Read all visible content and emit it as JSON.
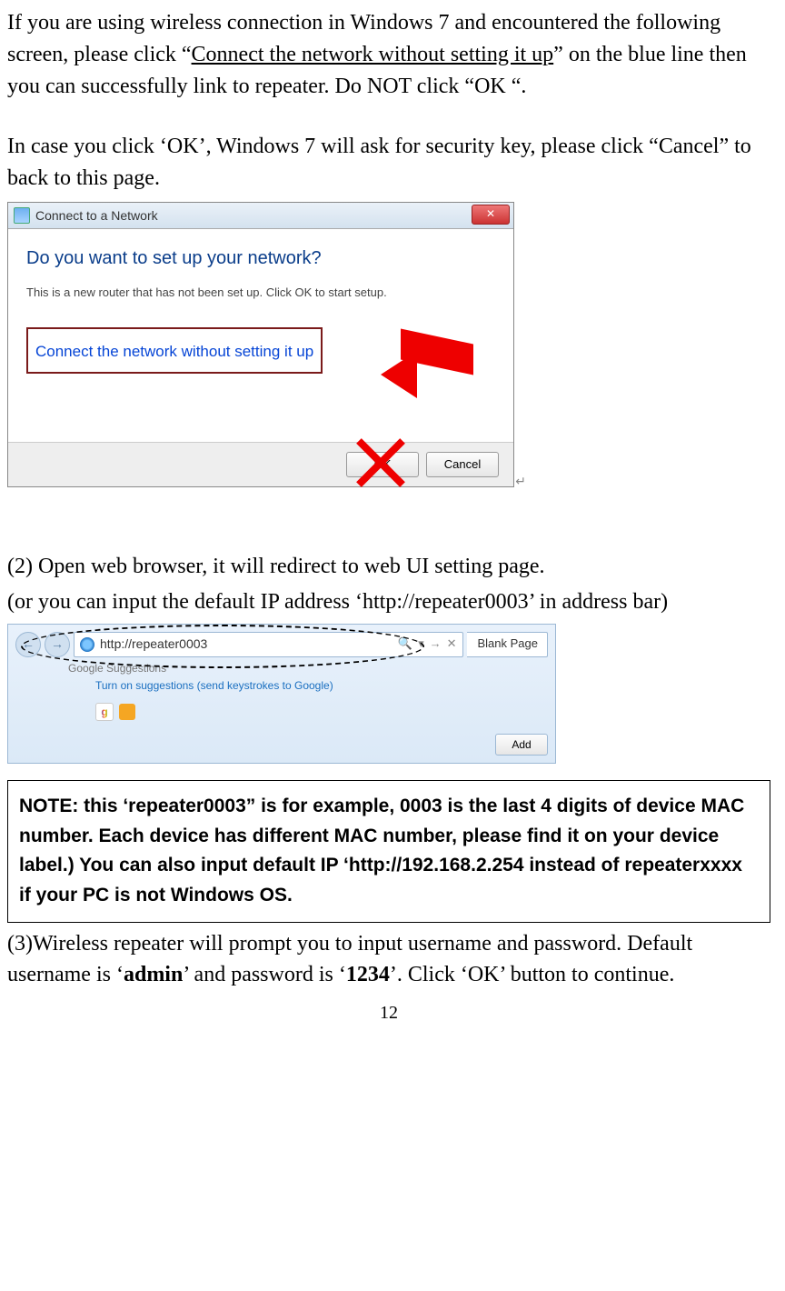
{
  "para1_a": "If you are using wireless connection in Windows 7 and encountered the following screen, please click “",
  "para1_link": "Connect the network without setting it up",
  "para1_b": "” on the blue line then you can successfully link to repeater. Do NOT click “OK “.",
  "para2": "In case you click ‘OK’, Windows 7 will ask for security key, please click “Cancel” to back to this page.",
  "dialog": {
    "title": "Connect to a Network",
    "close": "✕",
    "question": "Do you want to set up your network?",
    "subtitle": "This is a new router that has not been set up. Click OK to start setup.",
    "link": "Connect the network without setting it up",
    "ok": "OK",
    "cancel": "Cancel"
  },
  "step2_a": "(2) Open web browser, it will redirect to web UI setting page.",
  "step2_b": "(or you can input the default IP address ‘http://repeater0003’ in address bar)",
  "browser": {
    "url": "http://repeater0003",
    "tab": "Blank Page",
    "sugg_label": "Google Suggestions",
    "sugg_link": "Turn on suggestions (send keystrokes to Google)",
    "add": "Add",
    "search_glyph": "⍴",
    "arrow_glyph": "→",
    "x_glyph": "✕"
  },
  "note": "NOTE: this ‘repeater0003” is for example, 0003 is the last 4 digits of device MAC number. Each device has different MAC number, please find it on your device label.) You can also input default IP ‘http://192.168.2.254 instead of repeaterxxxx if your PC is not Windows OS.",
  "step3_a": "(3)Wireless repeater will prompt you to input username and password. Default username is ‘",
  "step3_admin": "admin",
  "step3_b": "’ and password is ‘",
  "step3_pw": "1234",
  "step3_c": "’. Click ‘OK’ button to continue.",
  "page_number": "12"
}
